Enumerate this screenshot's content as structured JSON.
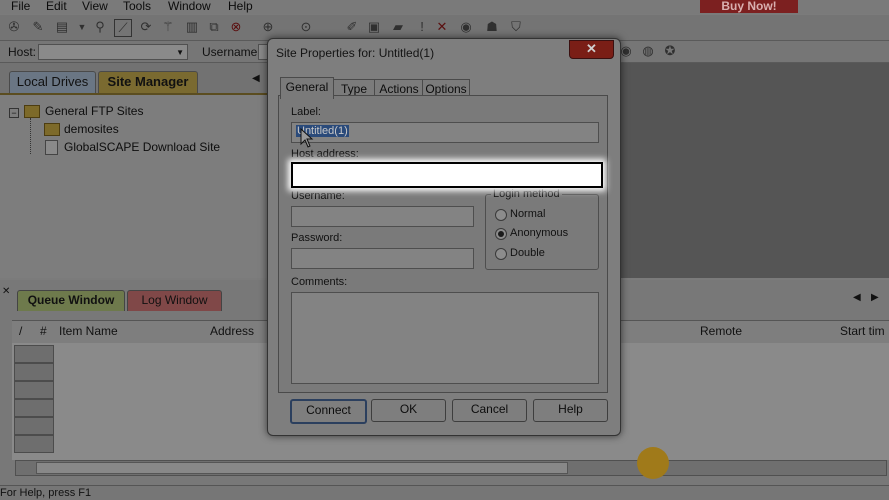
{
  "menu": [
    "File",
    "Edit",
    "View",
    "Tools",
    "Window",
    "Help"
  ],
  "buy_now": "Buy Now!",
  "toolbar_icons": [
    "open-book-icon",
    "wand-icon",
    "new-doc-icon",
    "dropdown-arrow-icon",
    "connect-icon",
    "disconnect-icon",
    "refresh-icon",
    "filter-icon",
    "print-icon",
    "copy-icon",
    "stop-icon",
    "download-icon",
    "upload-icon",
    "edit-icon",
    "compare-icon",
    "folder-icon",
    "important-icon",
    "delete-icon",
    "sync-icon",
    "power-icon",
    "shield-icon"
  ],
  "hostbar": {
    "host_label": "Host:",
    "username_label": "Username:"
  },
  "left_tabs": [
    "Local Drives",
    "Site Manager"
  ],
  "tree": {
    "root": "General FTP Sites",
    "children": [
      "demosites",
      "GlobalSCAPE Download Site"
    ]
  },
  "queue_tabs": [
    "Queue Window",
    "Log Window"
  ],
  "queue_columns": [
    "/",
    "#",
    "Item Name",
    "Address",
    "Remote",
    "Start tim"
  ],
  "status_text": "For Help, press F1",
  "dialog": {
    "title": "Site Properties for: Untitled(1)",
    "close": "✕",
    "tabs": [
      "General",
      "Type",
      "Actions",
      "Options"
    ],
    "label_label": "Label:",
    "label_value": "Untitled(1)",
    "host_label": "Host address:",
    "host_value": "",
    "username_label": "Username:",
    "password_label": "Password:",
    "login_method_label": "Login method",
    "login_options": [
      "Normal",
      "Anonymous",
      "Double"
    ],
    "login_selected": "Anonymous",
    "comments_label": "Comments:",
    "buttons": [
      "Connect",
      "OK",
      "Cancel",
      "Help"
    ]
  },
  "colors": {
    "highlight": "#ffffff",
    "dim_overlay": "#7b7b7b",
    "selection": "#2a4a7a"
  }
}
